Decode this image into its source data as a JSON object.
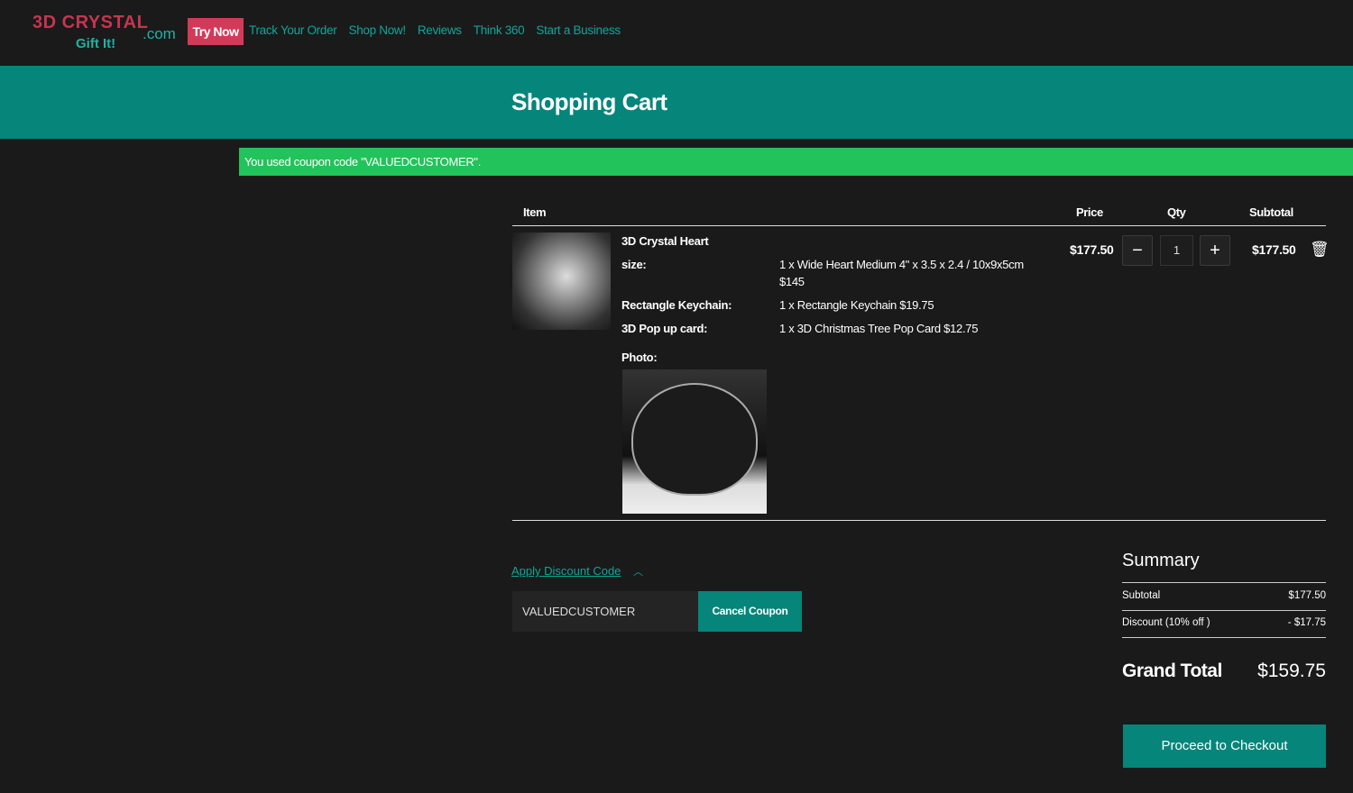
{
  "nav": {
    "logo_text": "3D CRYSTAL",
    "logo_sub": "Gift It!",
    "logo_domain": ".com",
    "try_now": "Try Now",
    "links": [
      "Track Your Order",
      "Shop Now!",
      "Reviews",
      "Think 360",
      "Start a Business"
    ]
  },
  "page_title": "Shopping Cart",
  "message": "You used coupon code \"VALUEDCUSTOMER\".",
  "table": {
    "headers": {
      "item": "Item",
      "price": "Price",
      "qty": "Qty",
      "subtotal": "Subtotal"
    }
  },
  "item": {
    "name": "3D Crystal Heart",
    "options": [
      {
        "label": "size:",
        "value": "1 x Wide Heart Medium 4\" x 3.5 x 2.4 / 10x9x5cm",
        "value2": "$145"
      },
      {
        "label": "Rectangle Keychain:",
        "value": "1 x Rectangle Keychain $19.75"
      },
      {
        "label": "3D Pop up card:",
        "value": "1 x 3D Christmas Tree Pop Card $12.75"
      }
    ],
    "photo_label": "Photo:",
    "price": "$177.50",
    "qty": "1",
    "subtotal": "$177.50"
  },
  "discount": {
    "link": "Apply Discount Code",
    "code": "VALUEDCUSTOMER",
    "cancel": "Cancel Coupon"
  },
  "summary": {
    "title": "Summary",
    "subtotal_label": "Subtotal",
    "subtotal": "$177.50",
    "discount_label": "Discount (10% off )",
    "discount": "- $17.75",
    "grand_label": "Grand Total",
    "grand": "$159.75",
    "checkout": "Proceed to Checkout"
  },
  "colors": {
    "teal": "#06857a",
    "link": "#0fa697",
    "success": "#22c35b",
    "brand_red": "#d33a5a"
  }
}
